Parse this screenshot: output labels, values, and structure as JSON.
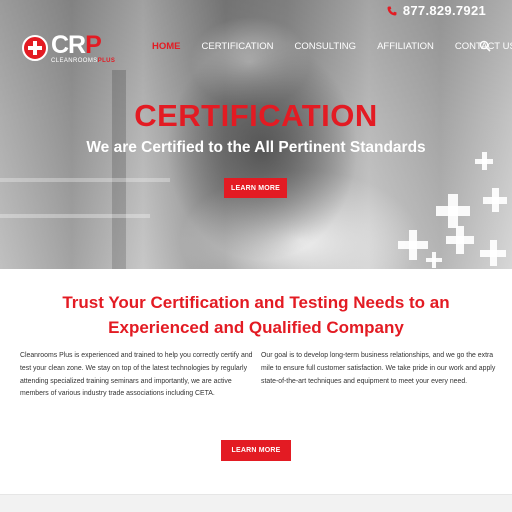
{
  "header": {
    "phone": "877.829.7921",
    "logo": {
      "mark_main": "CR",
      "mark_accent": "P",
      "tagline_main": "CLEANROOMS",
      "tagline_accent": "PLUS"
    },
    "nav": {
      "home": "HOME",
      "certification": "CERTIFICATION",
      "consulting": "CONSULTING",
      "affiliation": "AFFILIATION",
      "contact": "CONTACT US"
    }
  },
  "hero": {
    "title": "CERTIFICATION",
    "subtitle": "We are Certified to the All Pertinent Standards",
    "button": "LEARN MORE"
  },
  "main": {
    "heading_line1": "Trust Your Certification and Testing Needs to an",
    "heading_line2": "Experienced and Qualified Company",
    "left_text": "Cleanrooms Plus is experienced and trained to help you correctly certify and test your clean zone. We stay on top of the latest technologies by regularly attending specialized training seminars and importantly, we are active members of various industry trade associations including CETA.",
    "right_text": "Our goal is to develop long-term business relationships, and we go the extra mile to ensure full customer satisfaction. We take pride in our work and apply state-of-the-art techniques and equipment to meet your every need.",
    "button": "LEARN MORE"
  },
  "colors": {
    "accent": "#e31b23",
    "text": "#333333",
    "white": "#ffffff"
  },
  "icons": [
    "phone-icon",
    "search-icon",
    "logo-cross-icon"
  ]
}
